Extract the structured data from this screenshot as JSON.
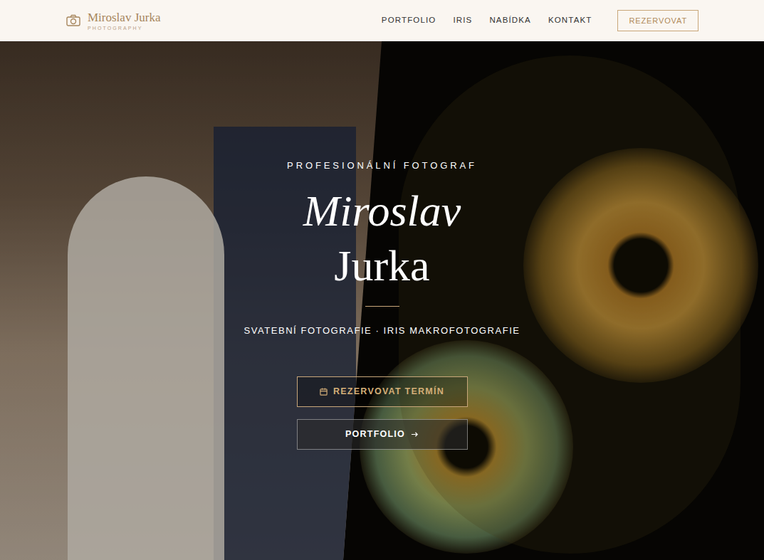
{
  "logo": {
    "name": "Miroslav Jurka",
    "tagline": "PHOTOGRAPHY"
  },
  "nav": [
    {
      "label": "PORTFOLIO"
    },
    {
      "label": "IRIS"
    },
    {
      "label": "NABÍDKA"
    },
    {
      "label": "KONTAKT"
    }
  ],
  "nav_button": "REZERVOVAT",
  "hero": {
    "eyebrow": "PROFESIONÁLNÍ FOTOGRAF",
    "first_name": "Miroslav",
    "last_name": "Jurka",
    "services": "SVATEBNÍ FOTOGRAFIE · IRIS MAKROFOTOGRAFIE",
    "buttons": [
      {
        "label": "REZERVOVAT TERMÍN",
        "kind": "primary"
      },
      {
        "label": "PORTFOLIO",
        "kind": "secondary"
      }
    ]
  }
}
